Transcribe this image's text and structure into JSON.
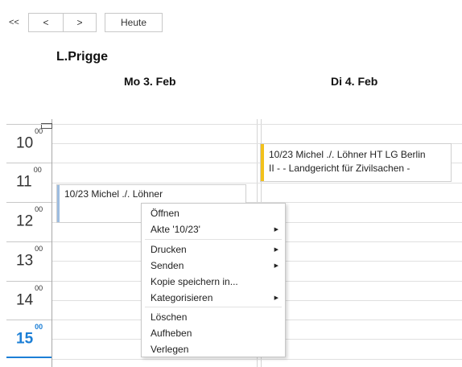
{
  "nav": {
    "first_label": "<<",
    "prev_label": "<",
    "next_label": ">",
    "today_label": "Heute"
  },
  "owner_label": "L.Prigge",
  "days": [
    {
      "label": "Mo 3. Feb"
    },
    {
      "label": "Di 4. Feb"
    }
  ],
  "times": [
    {
      "hour": "10",
      "min": "00"
    },
    {
      "hour": "11",
      "min": "00"
    },
    {
      "hour": "12",
      "min": "00"
    },
    {
      "hour": "13",
      "min": "00"
    },
    {
      "hour": "14",
      "min": "00"
    },
    {
      "hour": "15",
      "min": "00"
    }
  ],
  "appointments": {
    "monday": {
      "title": "10/23 Michel ./. Löhner",
      "color": "#9dbde0"
    },
    "tuesday": {
      "line1": "10/23 Michel ./. Löhner HT LG Berlin",
      "line2": "II - - Landgericht für Zivilsachen -",
      "color": "#f2c11c"
    }
  },
  "context_menu": {
    "open": "Öffnen",
    "file": "Akte '10/23'",
    "print": "Drucken",
    "send": "Senden",
    "save_copy": "Kopie speichern in...",
    "categorize": "Kategorisieren",
    "delete": "Löschen",
    "cancel": "Aufheben",
    "move": "Verlegen"
  },
  "colors": {
    "accent": "#1c7fd6"
  }
}
